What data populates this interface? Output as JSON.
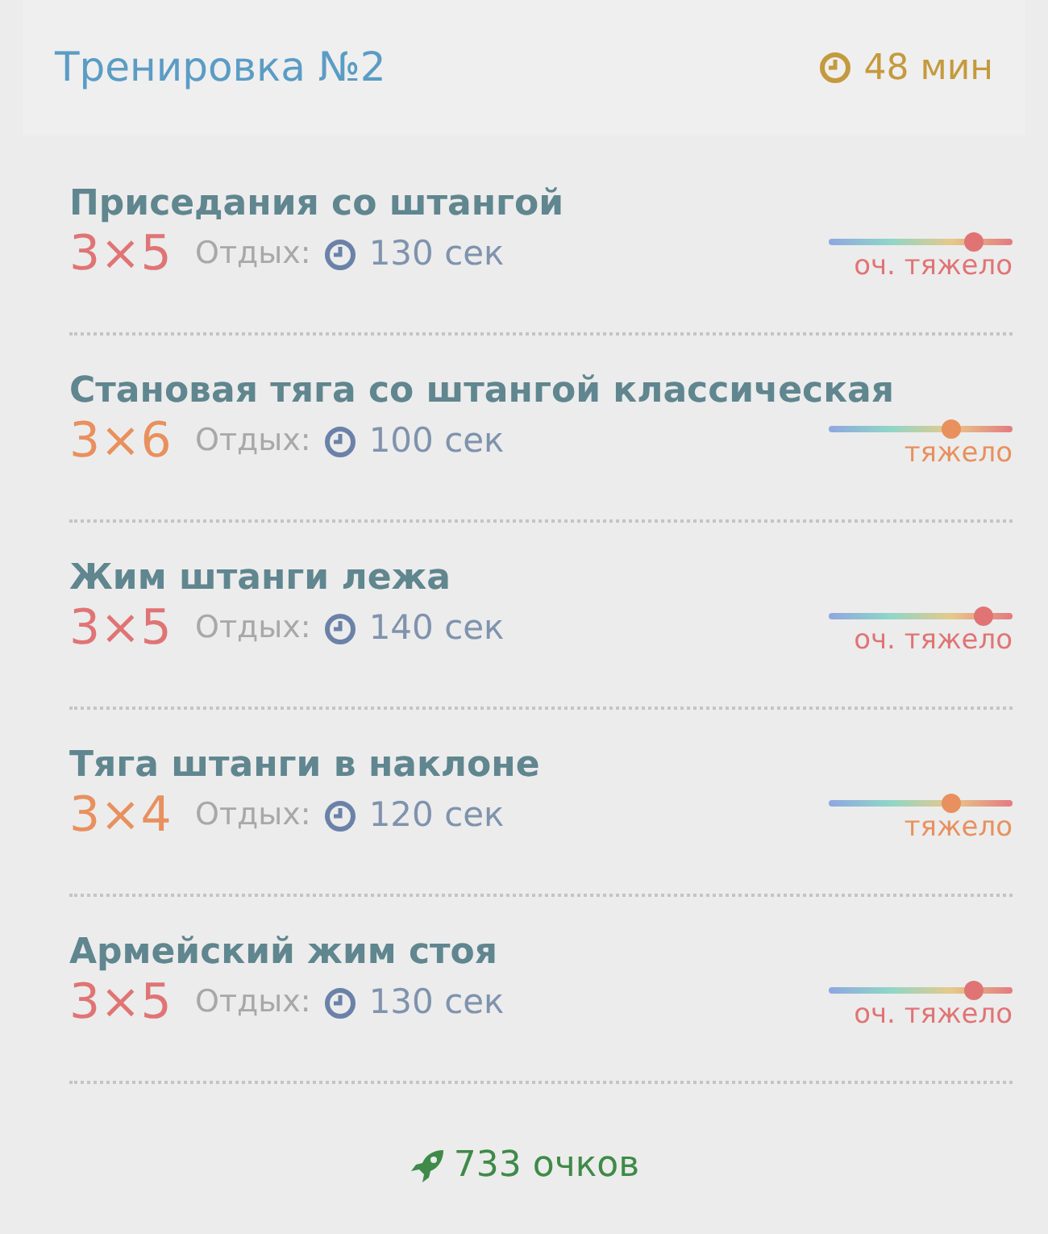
{
  "header": {
    "title": "Тренировка №2",
    "duration": "48 мин"
  },
  "exercises": [
    {
      "name": "Приседания со штангой",
      "sets": "3×5",
      "rest_label": "Отдых:",
      "rest": "130 сек",
      "level": 0.79,
      "difficulty": "оч. тяжело",
      "color": "#e07475"
    },
    {
      "name": "Становая тяга со штангой классическая",
      "sets": "3×6",
      "rest_label": "Отдых:",
      "rest": "100 сек",
      "level": 0.67,
      "difficulty": "тяжело",
      "color": "#e8905e"
    },
    {
      "name": "Жим штанги лежа",
      "sets": "3×5",
      "rest_label": "Отдых:",
      "rest": "140 сек",
      "level": 0.84,
      "difficulty": "оч. тяжело",
      "color": "#e07475"
    },
    {
      "name": "Тяга штанги в наклоне",
      "sets": "3×4",
      "rest_label": "Отдых:",
      "rest": "120 сек",
      "level": 0.67,
      "difficulty": "тяжело",
      "color": "#e8905e"
    },
    {
      "name": "Армейский жим стоя",
      "sets": "3×5",
      "rest_label": "Отдых:",
      "rest": "130 сек",
      "level": 0.79,
      "difficulty": "оч. тяжело",
      "color": "#e07475"
    }
  ],
  "score": "733 очков"
}
